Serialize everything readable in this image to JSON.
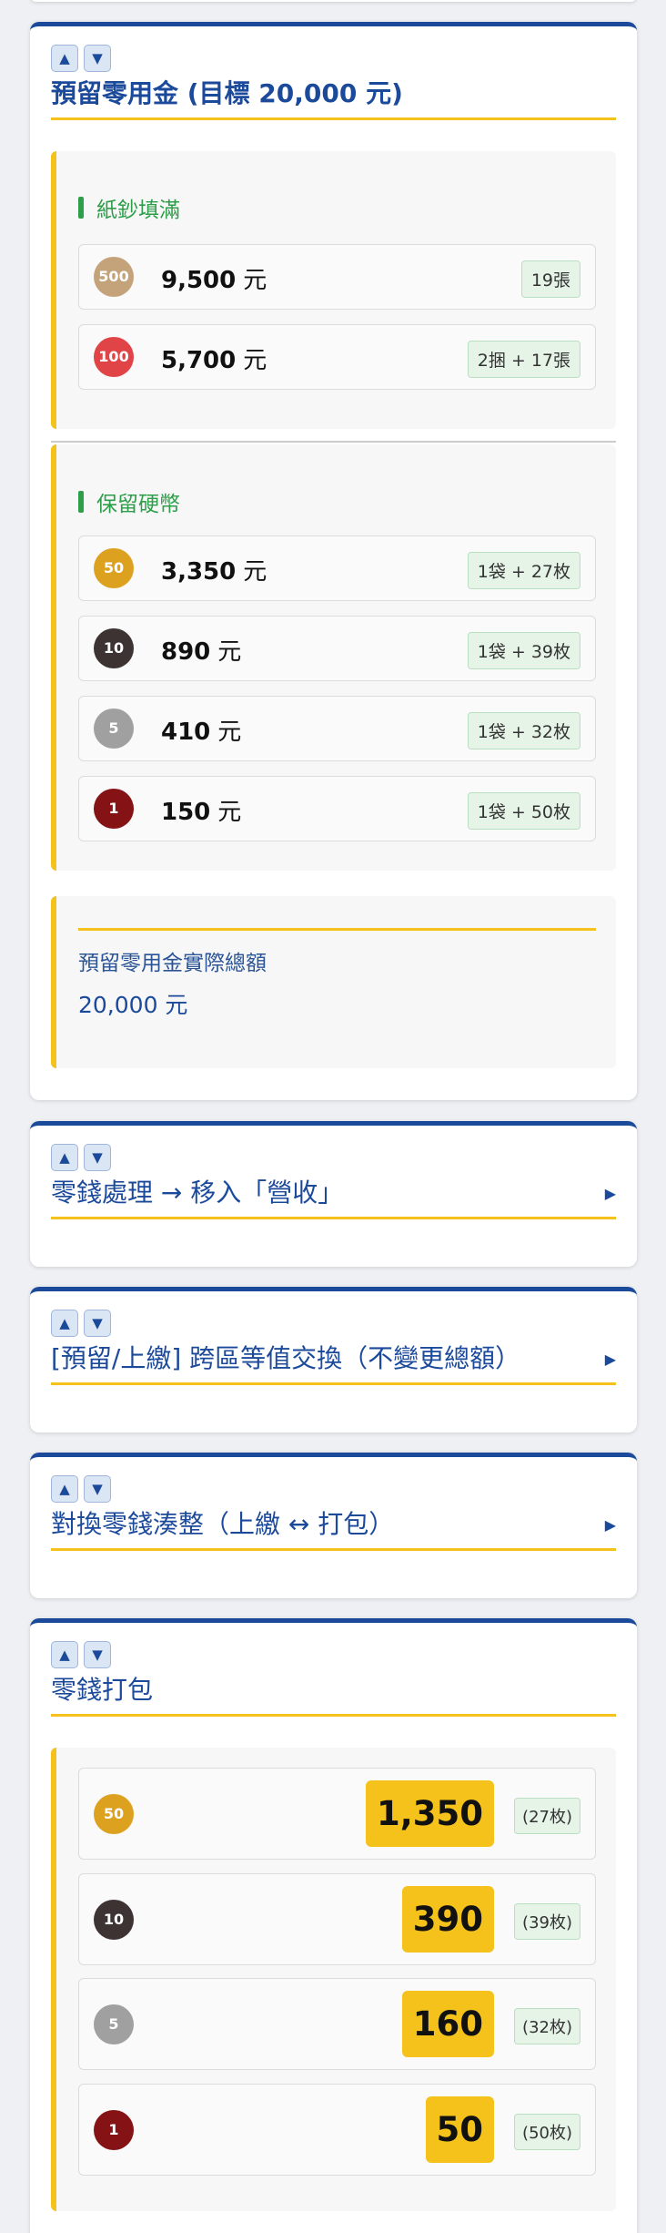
{
  "reserve": {
    "title": "預留零用金 (目標 20,000 元)",
    "up_label": "▲",
    "down_label": "▼",
    "bills_label": "紙鈔填滿",
    "bills": [
      {
        "denom": "500",
        "amount": "9,500",
        "unit": "元",
        "badge": "19張",
        "color": "#c4a37a"
      },
      {
        "denom": "100",
        "amount": "5,700",
        "unit": "元",
        "badge": "2捆 + 17張",
        "color": "#e04446"
      }
    ],
    "coins_label": "保留硬幣",
    "coins": [
      {
        "denom": "50",
        "amount": "3,350",
        "unit": "元",
        "badge": "1袋 + 27枚",
        "color": "#dca11f"
      },
      {
        "denom": "10",
        "amount": "890",
        "unit": "元",
        "badge": "1袋 + 39枚",
        "color": "#3d3333"
      },
      {
        "denom": "5",
        "amount": "410",
        "unit": "元",
        "badge": "1袋 + 32枚",
        "color": "#a0a0a0"
      },
      {
        "denom": "1",
        "amount": "150",
        "unit": "元",
        "badge": "1袋 + 50枚",
        "color": "#851316"
      }
    ],
    "total_label": "預留零用金實際總額",
    "total_value": "20,000 元"
  },
  "sections": [
    {
      "title": "零錢處理 → 移入「營收」",
      "expand_icon": "triangle-right-icon"
    },
    {
      "title": "[預留/上繳] 跨區等值交換（不變更總額）",
      "expand_icon": "triangle-right-icon"
    },
    {
      "title": "對換零錢湊整（上繳 ↔ 打包）",
      "expand_icon": "triangle-right-icon"
    }
  ],
  "packing": {
    "title": "零錢打包",
    "rows": [
      {
        "denom": "50",
        "value": "1,350",
        "count": "(27枚)",
        "color": "#dca11f"
      },
      {
        "denom": "10",
        "value": "390",
        "count": "(39枚)",
        "color": "#3d3333"
      },
      {
        "denom": "5",
        "value": "160",
        "count": "(32枚)",
        "color": "#a0a0a0"
      },
      {
        "denom": "1",
        "value": "50",
        "count": "(50枚)",
        "color": "#851316"
      }
    ]
  },
  "colors": {
    "accent": "#1c4a9b",
    "highlight": "#f5c21b",
    "green": "#2e9e4a"
  }
}
